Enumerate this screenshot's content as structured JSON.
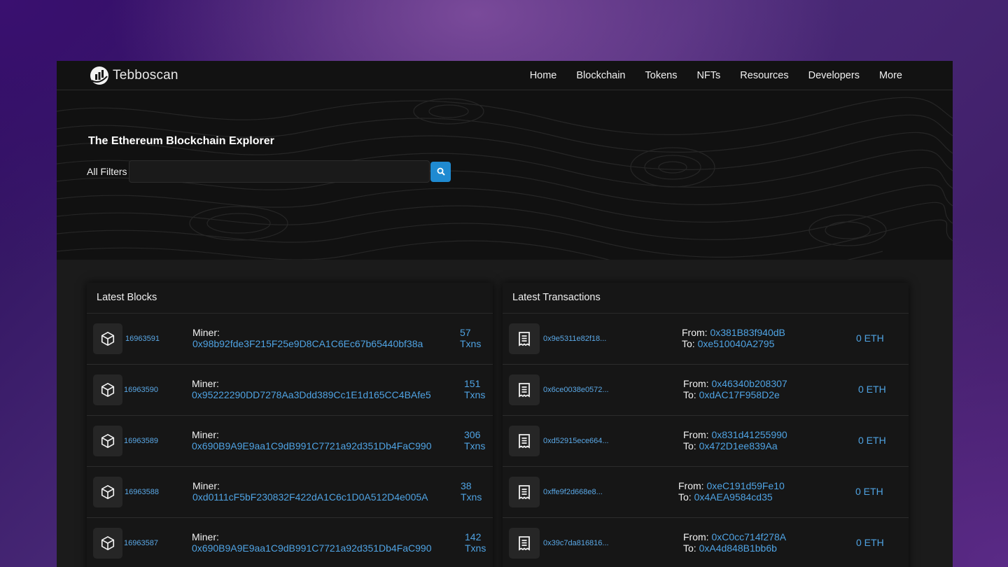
{
  "brand": {
    "name": "Tebboscan"
  },
  "nav": [
    "Home",
    "Blockchain",
    "Tokens",
    "NFTs",
    "Resources",
    "Developers",
    "More"
  ],
  "hero": {
    "title": "The Ethereum Blockchain Explorer",
    "filter_label": "All Filters",
    "search_value": "",
    "search_icon": "search-icon"
  },
  "latest_blocks": {
    "title": "Latest Blocks",
    "miner_label": "Miner:",
    "txns_label": "Txns",
    "icon": "cube-icon",
    "rows": [
      {
        "block": "16963591",
        "miner": "0x98b92fde3F215F25e9D8CA1C6Ec67b65440bf38a",
        "txns": "57"
      },
      {
        "block": "16963590",
        "miner": "0x95222290DD7278Aa3Ddd389Cc1E1d165CC4BAfe5",
        "txns": "151"
      },
      {
        "block": "16963589",
        "miner": "0x690B9A9E9aa1C9dB991C7721a92d351Db4FaC990",
        "txns": "306"
      },
      {
        "block": "16963588",
        "miner": "0xd0111cF5bF230832F422dA1C6c1D0A512D4e005A",
        "txns": "38"
      },
      {
        "block": "16963587",
        "miner": "0x690B9A9E9aa1C9dB991C7721a92d351Db4FaC990",
        "txns": "142"
      }
    ]
  },
  "latest_transactions": {
    "title": "Latest Transactions",
    "from_label": "From:",
    "to_label": "To:",
    "icon": "receipt-icon",
    "rows": [
      {
        "hash": "0x9e5311e82f18...",
        "from": "0x381B83f940dB",
        "to": "0xe510040A2795",
        "value": "0 ETH"
      },
      {
        "hash": "0x6ce0038e0572...",
        "from": "0x46340b208307",
        "to": "0xdAC17F958D2e",
        "value": "0 ETH"
      },
      {
        "hash": "0xd52915ece664...",
        "from": "0x831d41255990",
        "to": "0x472D1ee839Aa",
        "value": "0 ETH"
      },
      {
        "hash": "0xffe9f2d668e8...",
        "from": "0xeC191d59Fe10",
        "to": "0x4AEA9584cd35",
        "value": "0 ETH"
      },
      {
        "hash": "0x39c7da816816...",
        "from": "0xC0cc714f278A",
        "to": "0xA4d848B1bb6b",
        "value": "0 ETH"
      }
    ]
  },
  "colors": {
    "link": "#4fa3e3",
    "search_button": "#1f8ad1",
    "background": "#1b1b1b"
  }
}
